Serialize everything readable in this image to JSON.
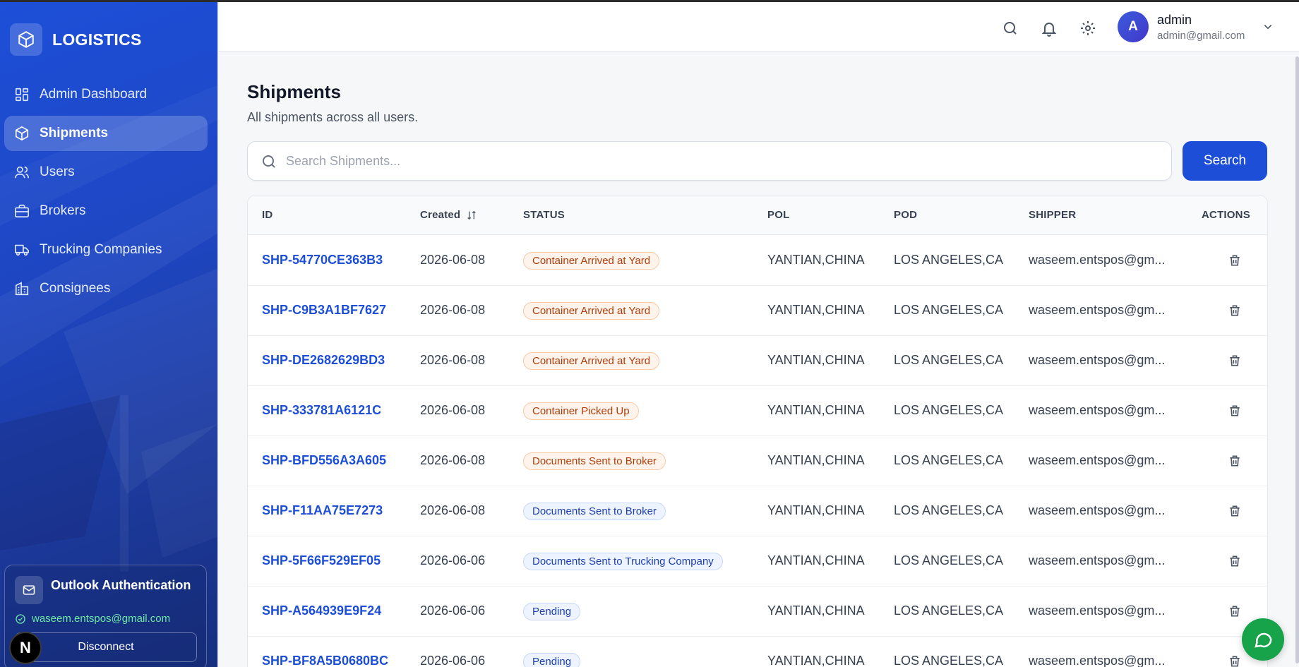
{
  "brand": {
    "name": "LOGISTICS"
  },
  "sidebar": {
    "items": [
      {
        "label": "Admin Dashboard",
        "icon": "dashboard-icon",
        "active": false
      },
      {
        "label": "Shipments",
        "icon": "box-icon",
        "active": true
      },
      {
        "label": "Users",
        "icon": "users-icon",
        "active": false
      },
      {
        "label": "Brokers",
        "icon": "briefcase-icon",
        "active": false
      },
      {
        "label": "Trucking Companies",
        "icon": "truck-icon",
        "active": false
      },
      {
        "label": "Consignees",
        "icon": "building-icon",
        "active": false
      }
    ],
    "outlook": {
      "title": "Outlook Authentication",
      "email": "waseem.entspos@gmail.com",
      "disconnect_label": "Disconnect"
    },
    "next_badge": "N"
  },
  "header": {
    "user": {
      "initial": "A",
      "name": "admin",
      "email": "admin@gmail.com"
    }
  },
  "page": {
    "title": "Shipments",
    "subtitle": "All shipments across all users.",
    "search": {
      "placeholder": "Search Shipments...",
      "value": "",
      "button_label": "Search"
    }
  },
  "table": {
    "columns": {
      "id": "ID",
      "created": "Created",
      "status": "STATUS",
      "pol": "POL",
      "pod": "POD",
      "shipper": "SHIPPER",
      "actions": "ACTIONS"
    },
    "rows": [
      {
        "id": "SHP-54770CE363B3",
        "created": "2026-06-08",
        "status": "Container Arrived at Yard",
        "tone": "orange",
        "pol": "YANTIAN,CHINA",
        "pod": "LOS ANGELES,CA",
        "shipper": "waseem.entspos@gm..."
      },
      {
        "id": "SHP-C9B3A1BF7627",
        "created": "2026-06-08",
        "status": "Container Arrived at Yard",
        "tone": "orange",
        "pol": "YANTIAN,CHINA",
        "pod": "LOS ANGELES,CA",
        "shipper": "waseem.entspos@gm..."
      },
      {
        "id": "SHP-DE2682629BD3",
        "created": "2026-06-08",
        "status": "Container Arrived at Yard",
        "tone": "orange",
        "pol": "YANTIAN,CHINA",
        "pod": "LOS ANGELES,CA",
        "shipper": "waseem.entspos@gm..."
      },
      {
        "id": "SHP-333781A6121C",
        "created": "2026-06-08",
        "status": "Container Picked Up",
        "tone": "orange",
        "pol": "YANTIAN,CHINA",
        "pod": "LOS ANGELES,CA",
        "shipper": "waseem.entspos@gm..."
      },
      {
        "id": "SHP-BFD556A3A605",
        "created": "2026-06-08",
        "status": "Documents Sent to Broker",
        "tone": "orange",
        "pol": "YANTIAN,CHINA",
        "pod": "LOS ANGELES,CA",
        "shipper": "waseem.entspos@gm..."
      },
      {
        "id": "SHP-F11AA75E7273",
        "created": "2026-06-08",
        "status": "Documents Sent to Broker",
        "tone": "blue",
        "pol": "YANTIAN,CHINA",
        "pod": "LOS ANGELES,CA",
        "shipper": "waseem.entspos@gm..."
      },
      {
        "id": "SHP-5F66F529EF05",
        "created": "2026-06-06",
        "status": "Documents Sent to Trucking Company",
        "tone": "blue",
        "pol": "YANTIAN,CHINA",
        "pod": "LOS ANGELES,CA",
        "shipper": "waseem.entspos@gm..."
      },
      {
        "id": "SHP-A564939E9F24",
        "created": "2026-06-06",
        "status": "Pending",
        "tone": "blue",
        "pol": "YANTIAN,CHINA",
        "pod": "LOS ANGELES,CA",
        "shipper": "waseem.entspos@gm..."
      },
      {
        "id": "SHP-BF8A5B0680BC",
        "created": "2026-06-06",
        "status": "Pending",
        "tone": "blue",
        "pol": "YANTIAN,CHINA",
        "pod": "LOS ANGELES,CA",
        "shipper": "waseem.entspos@gm..."
      }
    ]
  },
  "colors": {
    "primary": "#1d4ed8",
    "sidebar": "#1e46c2",
    "chat": "#16a34a"
  }
}
